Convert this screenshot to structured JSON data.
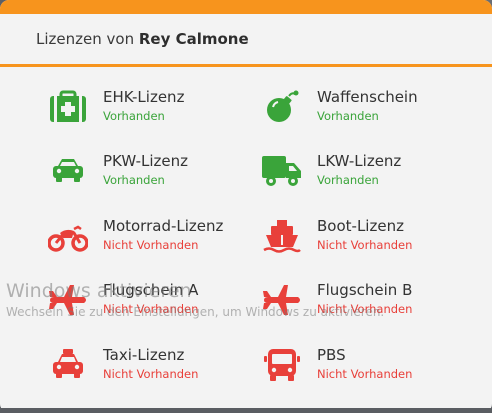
{
  "header": {
    "prefix": "Lizenzen von",
    "name": "Rey Calmone"
  },
  "licenses": [
    {
      "name": "EHK-Lizenz",
      "status": "Vorhanden",
      "icon": "first-aid-kit-icon"
    },
    {
      "name": "Waffenschein",
      "status": "Vorhanden",
      "icon": "bomb-icon"
    },
    {
      "name": "PKW-Lizenz",
      "status": "Vorhanden",
      "icon": "car-icon"
    },
    {
      "name": "LKW-Lizenz",
      "status": "Vorhanden",
      "icon": "truck-icon"
    },
    {
      "name": "Motorrad-Lizenz",
      "status": "Nicht Vorhanden",
      "icon": "motorcycle-icon"
    },
    {
      "name": "Boot-Lizenz",
      "status": "Nicht Vorhanden",
      "icon": "ship-icon"
    },
    {
      "name": "Flugschein A",
      "status": "Nicht Vorhanden",
      "icon": "plane-icon"
    },
    {
      "name": "Flugschein B",
      "status": "Nicht Vorhanden",
      "icon": "plane-icon"
    },
    {
      "name": "Taxi-Lizenz",
      "status": "Nicht Vorhanden",
      "icon": "taxi-icon"
    },
    {
      "name": "PBS",
      "status": "Nicht Vorhanden",
      "icon": "bus-icon"
    }
  ],
  "watermark": {
    "line1": "Windows aktivieren",
    "line2": "Wechseln Sie zu den Einstellungen, um Windows zu aktivieren."
  },
  "colors": {
    "accent": "#f7941d",
    "available": "#3aa43a",
    "unavailable": "#e8403a"
  }
}
